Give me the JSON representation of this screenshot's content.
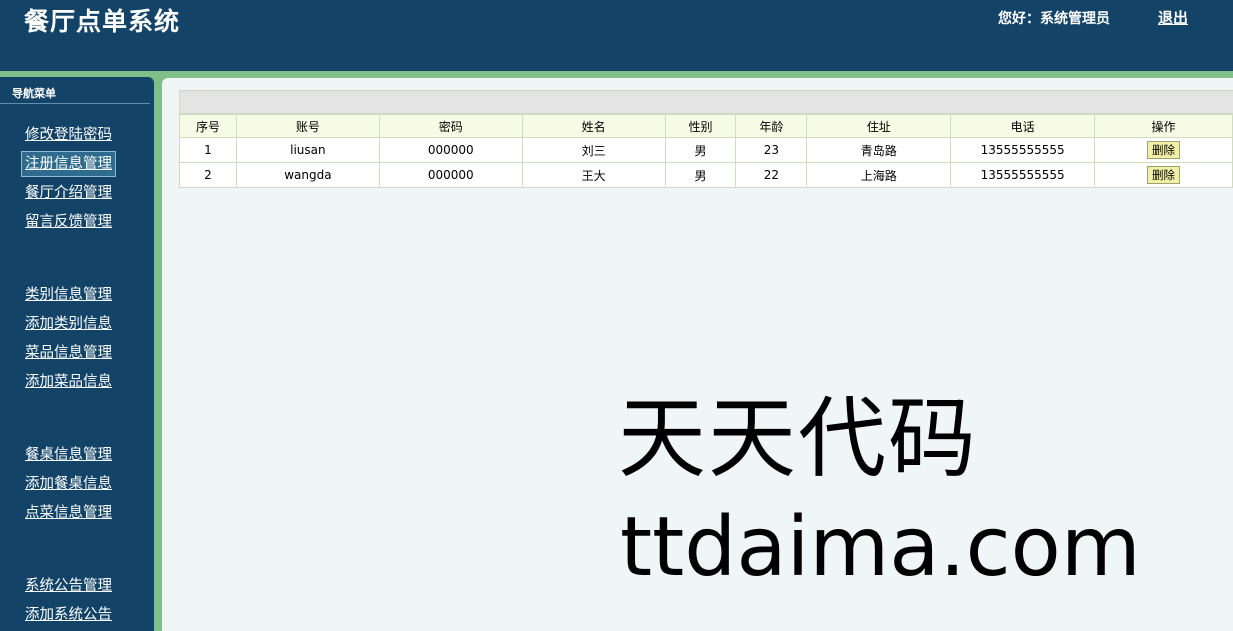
{
  "header": {
    "title": "餐厅点单系统",
    "greeting": "您好：系统管理员",
    "logout": "退出"
  },
  "sidebar": {
    "heading": "导航菜单",
    "items": [
      {
        "label": "修改登陆密码"
      },
      {
        "label": "注册信息管理",
        "active": true
      },
      {
        "label": "餐厅介绍管理"
      },
      {
        "label": "留言反馈管理"
      },
      {
        "label": "类别信息管理"
      },
      {
        "label": "添加类别信息"
      },
      {
        "label": "菜品信息管理"
      },
      {
        "label": "添加菜品信息"
      },
      {
        "label": "餐桌信息管理"
      },
      {
        "label": "添加餐桌信息"
      },
      {
        "label": "点菜信息管理"
      },
      {
        "label": "系统公告管理"
      },
      {
        "label": "添加系统公告"
      }
    ]
  },
  "table": {
    "headers": [
      "序号",
      "账号",
      "密码",
      "姓名",
      "性别",
      "年龄",
      "住址",
      "电话",
      "操作"
    ],
    "rows": [
      [
        "1",
        "liusan",
        "000000",
        "刘三",
        "男",
        "23",
        "青岛路",
        "13555555555"
      ],
      [
        "2",
        "wangda",
        "000000",
        "王大",
        "男",
        "22",
        "上海路",
        "13555555555"
      ]
    ],
    "action_label": "删除"
  },
  "watermark": {
    "line1": "天天代码",
    "line2": "ttdaima.com"
  }
}
